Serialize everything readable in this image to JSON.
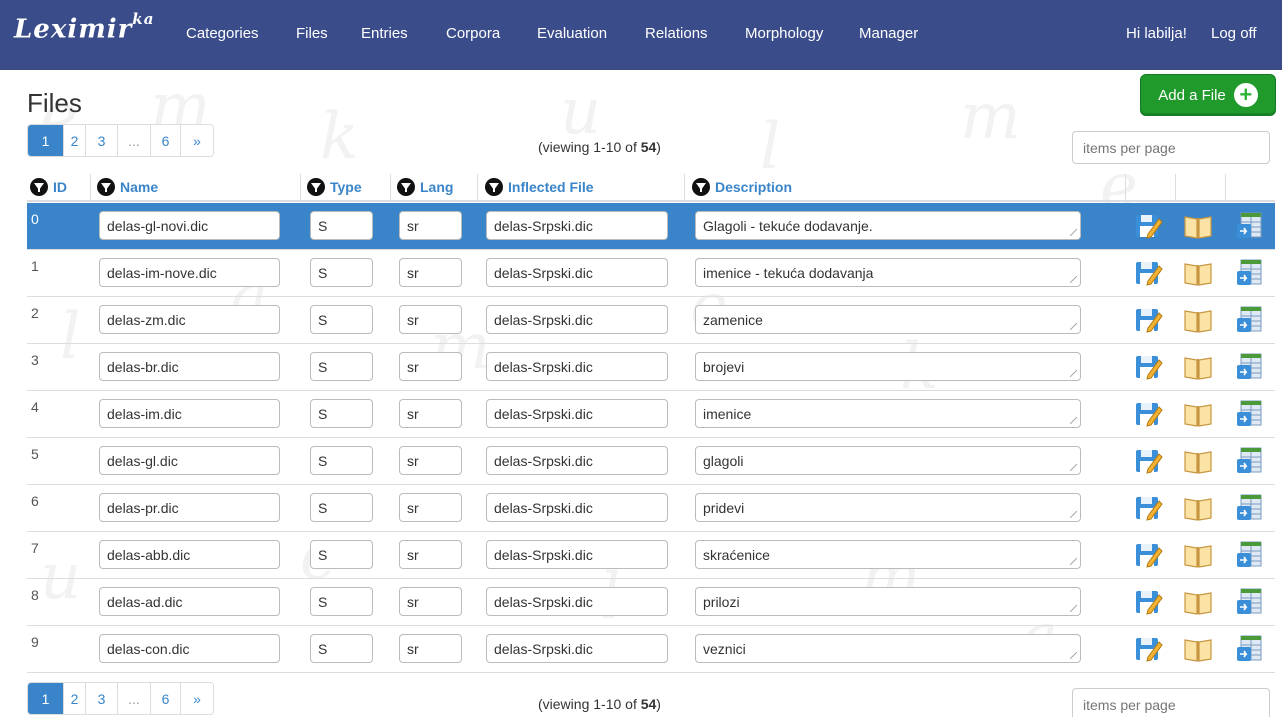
{
  "app": {
    "logo": "Leximir",
    "logo_sup": "ka"
  },
  "nav": {
    "items": [
      "Categories",
      "Files",
      "Entries",
      "Corpora",
      "Evaluation",
      "Relations",
      "Morphology",
      "Manager"
    ],
    "greeting": "Hi labilja!",
    "logoff": "Log off"
  },
  "page": {
    "title": "Files",
    "add_label": "Add a File"
  },
  "pager": {
    "pages": [
      "1",
      "2",
      "3",
      "...",
      "6",
      "»"
    ],
    "active": "1"
  },
  "viewing": {
    "prefix": "(viewing 1-10 of ",
    "total": "54",
    "suffix": ")"
  },
  "items_per_page_placeholder": "items per page",
  "columns": [
    "ID",
    "Name",
    "Type",
    "Lang",
    "Inflected File",
    "Description"
  ],
  "rows": [
    {
      "id": "0",
      "name": "delas-gl-novi.dic",
      "type": "S",
      "lang": "sr",
      "inflected": "delas-Srpski.dic",
      "description": "Glagoli - tekuće dodavanje."
    },
    {
      "id": "1",
      "name": "delas-im-nove.dic",
      "type": "S",
      "lang": "sr",
      "inflected": "delas-Srpski.dic",
      "description": "imenice - tekuća dodavanja"
    },
    {
      "id": "2",
      "name": "delas-zm.dic",
      "type": "S",
      "lang": "sr",
      "inflected": "delas-Srpski.dic",
      "description": "zamenice"
    },
    {
      "id": "3",
      "name": "delas-br.dic",
      "type": "S",
      "lang": "sr",
      "inflected": "delas-Srpski.dic",
      "description": "brojevi"
    },
    {
      "id": "4",
      "name": "delas-im.dic",
      "type": "S",
      "lang": "sr",
      "inflected": "delas-Srpski.dic",
      "description": "imenice"
    },
    {
      "id": "5",
      "name": "delas-gl.dic",
      "type": "S",
      "lang": "sr",
      "inflected": "delas-Srpski.dic",
      "description": "glagoli"
    },
    {
      "id": "6",
      "name": "delas-pr.dic",
      "type": "S",
      "lang": "sr",
      "inflected": "delas-Srpski.dic",
      "description": "pridevi"
    },
    {
      "id": "7",
      "name": "delas-abb.dic",
      "type": "S",
      "lang": "sr",
      "inflected": "delas-Srpski.dic",
      "description": "skraćenice"
    },
    {
      "id": "8",
      "name": "delas-ad.dic",
      "type": "S",
      "lang": "sr",
      "inflected": "delas-Srpski.dic",
      "description": "prilozi"
    },
    {
      "id": "9",
      "name": "delas-con.dic",
      "type": "S",
      "lang": "sr",
      "inflected": "delas-Srpski.dic",
      "description": "veznici"
    }
  ],
  "colors": {
    "navbar": "#3a4d8a",
    "accent": "#3a85c9",
    "add_button": "#1f9a2b"
  },
  "icons": [
    "save-icon",
    "book-icon",
    "table-icon",
    "filter-icon",
    "plus-icon"
  ]
}
